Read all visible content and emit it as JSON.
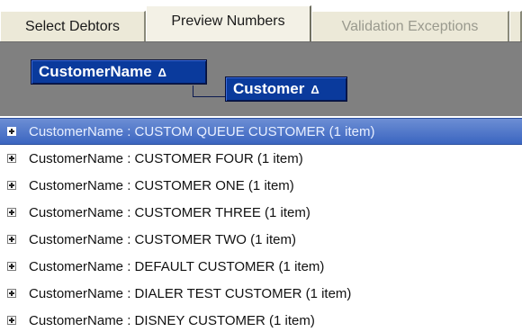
{
  "tabs": [
    {
      "label": "Select Debtors",
      "state": "normal"
    },
    {
      "label": "Preview Numbers",
      "state": "active"
    },
    {
      "label": "Validation Exceptions",
      "state": "disabled"
    }
  ],
  "group_by": {
    "chips": [
      {
        "label": "CustomerName",
        "sort_icon": "sort-ascending-icon"
      },
      {
        "label": "Customer",
        "sort_icon": "sort-ascending-icon"
      }
    ]
  },
  "groups": [
    {
      "text": "CustomerName : CUSTOM QUEUE CUSTOMER (1 item)",
      "selected": true
    },
    {
      "text": "CustomerName : CUSTOMER FOUR (1 item)",
      "selected": false
    },
    {
      "text": "CustomerName : CUSTOMER ONE (1 item)",
      "selected": false
    },
    {
      "text": "CustomerName : CUSTOMER THREE (1 item)",
      "selected": false
    },
    {
      "text": "CustomerName : CUSTOMER TWO (1 item)",
      "selected": false
    },
    {
      "text": "CustomerName : DEFAULT CUSTOMER (1 item)",
      "selected": false
    },
    {
      "text": "CustomerName : DIALER TEST CUSTOMER (1 item)",
      "selected": false
    },
    {
      "text": "CustomerName : DISNEY CUSTOMER (1 item)",
      "selected": false
    }
  ],
  "colors": {
    "tab_bg": "#ece9d8",
    "groupby_bg": "#808080",
    "chip_bg": "#0a3a9c",
    "selection": "#3b65c0"
  }
}
